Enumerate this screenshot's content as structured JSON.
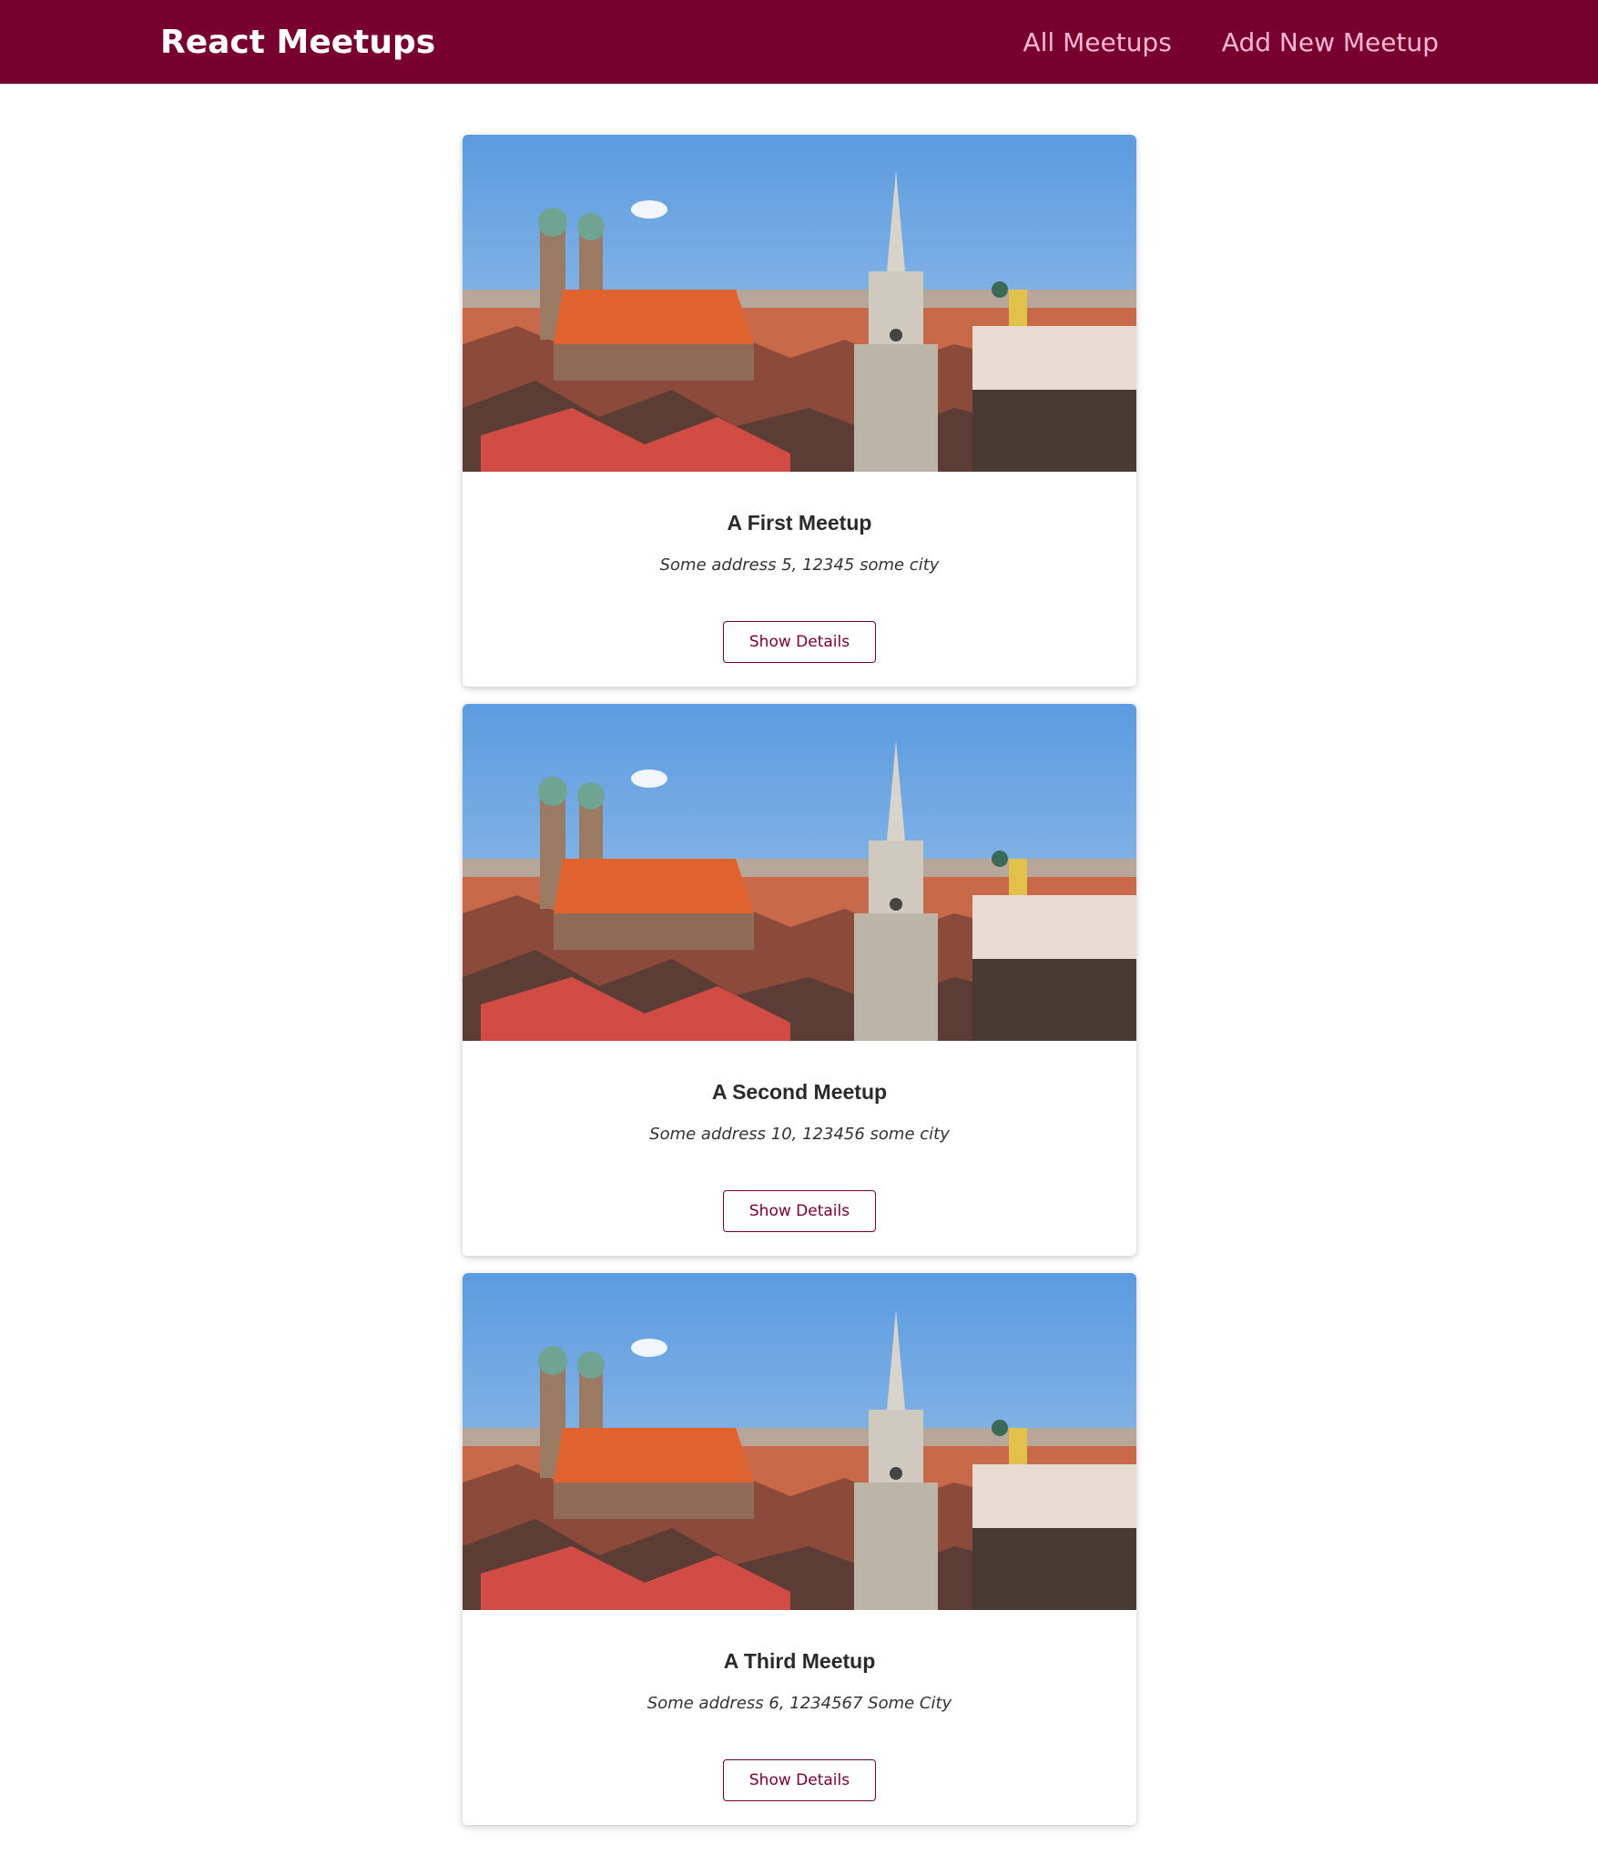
{
  "header": {
    "logo": "React Meetups",
    "nav": [
      "All Meetups",
      "Add New Meetup"
    ]
  },
  "colors": {
    "brand": "#77002e",
    "nav_link": "#fcb8d2",
    "button_text": "#77002e"
  },
  "meetups": [
    {
      "image": "munich-cityscape-photo",
      "title": "A First Meetup",
      "address": "Some address 5, 12345 some city",
      "button": "Show Details"
    },
    {
      "image": "munich-cityscape-photo",
      "title": "A Second Meetup",
      "address": "Some address 10, 123456 some city",
      "button": "Show Details"
    },
    {
      "image": "munich-cityscape-photo",
      "title": "A Third Meetup",
      "address": "Some address 6, 1234567 Some City",
      "button": "Show Details"
    }
  ]
}
